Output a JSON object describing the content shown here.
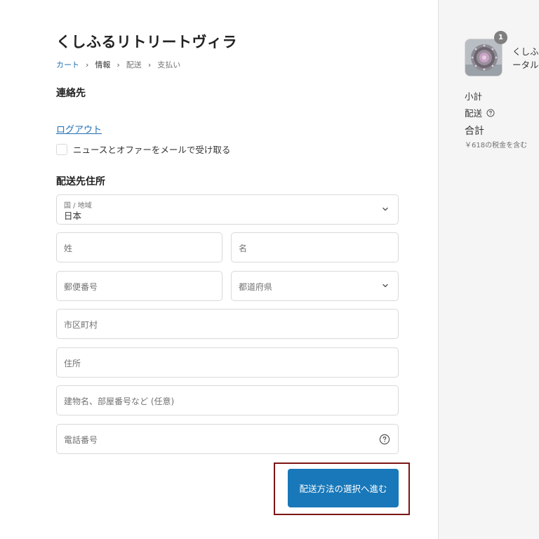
{
  "store": {
    "title": "くしふるリトリートヴィラ"
  },
  "breadcrumb": {
    "cart": "カート",
    "info": "情報",
    "shipping": "配送",
    "payment": "支払い",
    "separator": "›"
  },
  "contact": {
    "heading": "連絡先",
    "logout": "ログアウト",
    "newsletter_label": "ニュースとオファーをメールで受け取る",
    "newsletter_checked": false
  },
  "address": {
    "heading": "配送先住所",
    "country": {
      "label": "国 / 地域",
      "value": "日本"
    },
    "last_name": {
      "placeholder": "姓"
    },
    "first_name": {
      "placeholder": "名"
    },
    "postal_code": {
      "placeholder": "郵便番号"
    },
    "prefecture": {
      "placeholder": "都道府県"
    },
    "city": {
      "placeholder": "市区町村"
    },
    "street": {
      "placeholder": "住所"
    },
    "building": {
      "placeholder": "建物名、部屋番号など (任意)"
    },
    "phone": {
      "placeholder": "電話番号"
    }
  },
  "actions": {
    "continue_label": "配送方法の選択へ進む"
  },
  "summary": {
    "item_quantity": "1",
    "item_name_line1": "くしふる",
    "item_name_line2": "ータル",
    "subtotal_label": "小計",
    "shipping_label": "配送",
    "total_label": "合計",
    "tax_note": "￥618の税金を含む"
  },
  "colors": {
    "accent": "#1878b9",
    "link": "#1f6fb3",
    "highlight_border": "#7e1515",
    "sidebar_bg": "#f5f5f5"
  },
  "icons": {
    "chevron": "chevron-down-icon",
    "help": "help-circle-icon",
    "separator": "chevron-right-icon"
  }
}
